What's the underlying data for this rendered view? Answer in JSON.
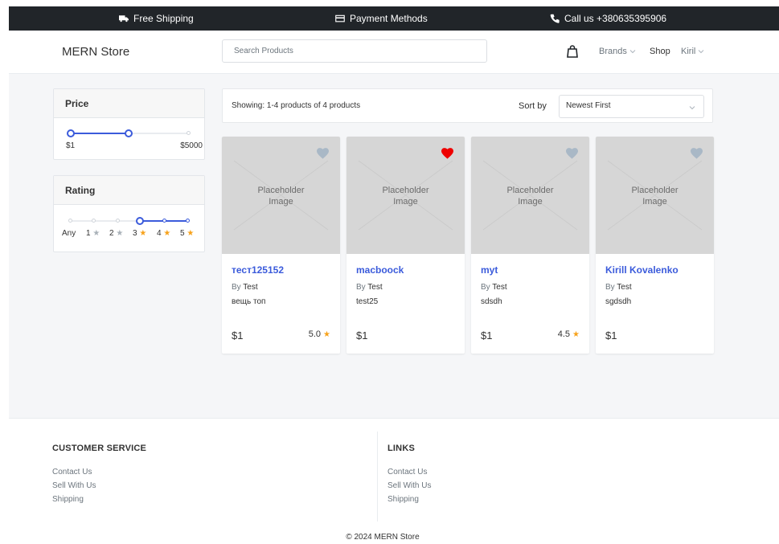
{
  "topbar": {
    "shipping": "Free Shipping",
    "payment": "Payment Methods",
    "call": "Call us +380635395906"
  },
  "header": {
    "brand": "MERN Store",
    "search_placeholder": "Search Products",
    "nav": {
      "brands": "Brands",
      "shop": "Shop",
      "user": "Kiril"
    }
  },
  "filters": {
    "price": {
      "title": "Price",
      "min_label": "$1",
      "max_label": "$5000",
      "selected_fraction": [
        0.0,
        0.49
      ]
    },
    "rating": {
      "title": "Rating",
      "labels": [
        "Any",
        "1",
        "2",
        "3",
        "4",
        "5"
      ],
      "selected_range": [
        3,
        5
      ]
    }
  },
  "toolbar": {
    "showing": "Showing: 1-4 products of 4 products",
    "sort_label": "Sort by",
    "sort_value": "Newest First"
  },
  "products": [
    {
      "name": "тест125152",
      "by_prefix": "By",
      "brand": "Test",
      "desc": "вещь топ",
      "price": "$1",
      "rating": "5.0",
      "favorite": false,
      "placeholder": "Placeholder\nImage"
    },
    {
      "name": "macboock",
      "by_prefix": "By",
      "brand": "Test",
      "desc": "test25",
      "price": "$1",
      "rating": "",
      "favorite": true,
      "placeholder": "Placeholder\nImage"
    },
    {
      "name": "myt",
      "by_prefix": "By",
      "brand": "Test",
      "desc": "sdsdh",
      "price": "$1",
      "rating": "4.5",
      "favorite": false,
      "placeholder": "Placeholder\nImage"
    },
    {
      "name": "Kirill Kovalenko",
      "by_prefix": "By",
      "brand": "Test",
      "desc": "sgdsdh",
      "price": "$1",
      "rating": "",
      "favorite": false,
      "placeholder": "Placeholder\nImage"
    }
  ],
  "footer": {
    "customer_service": {
      "title": "CUSTOMER SERVICE",
      "links": [
        "Contact Us",
        "Sell With Us",
        "Shipping"
      ]
    },
    "links": {
      "title": "LINKS",
      "links": [
        "Contact Us",
        "Sell With Us",
        "Shipping"
      ]
    },
    "copyright": "© 2024 MERN Store"
  },
  "colors": {
    "accent": "#3b5bdb",
    "star": "#f7a21b",
    "heart_active": "#ee0000",
    "heart_inactive": "#a9b8c6",
    "topbar": "#212529"
  }
}
